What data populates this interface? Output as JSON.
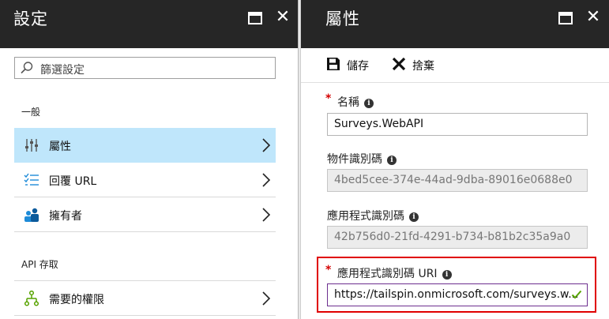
{
  "settings_blade": {
    "title": "設定",
    "search": {
      "placeholder": "篩選設定"
    },
    "section_general": "一般",
    "items_general": [
      {
        "label": "屬性",
        "icon": "sliders-icon",
        "selected": true
      },
      {
        "label": "回覆 URL",
        "icon": "list-icon",
        "selected": false
      },
      {
        "label": "擁有者",
        "icon": "owners-icon",
        "selected": false
      }
    ],
    "section_api": "API 存取",
    "items_api": [
      {
        "label": "需要的權限",
        "icon": "permissions-icon",
        "selected": false
      }
    ]
  },
  "properties_blade": {
    "title": "屬性",
    "commands": {
      "save": "儲存",
      "discard": "捨棄"
    },
    "fields": {
      "name": {
        "label": "名稱",
        "value": "Surveys.WebAPI",
        "required": true
      },
      "object_id": {
        "label": "物件識別碼",
        "value": "4bed5cee-374e-44ad-9dba-89016e0688e0"
      },
      "app_id": {
        "label": "應用程式識別碼",
        "value": "42b756d0-21fd-4291-b734-b81b2c35a9a0"
      },
      "app_id_uri": {
        "label": "應用程式識別碼 URI",
        "value": "https://tailspin.onmicrosoft.com/surveys.w...",
        "required": true
      }
    }
  },
  "colors": {
    "header_bg": "#262626",
    "selected_bg": "#bfe6fb",
    "accent_blue": "#0072c6",
    "required_red": "#d40000",
    "highlight_red": "#e00000",
    "valid_green": "#57a300",
    "focus_purple": "#6d2f8f"
  }
}
